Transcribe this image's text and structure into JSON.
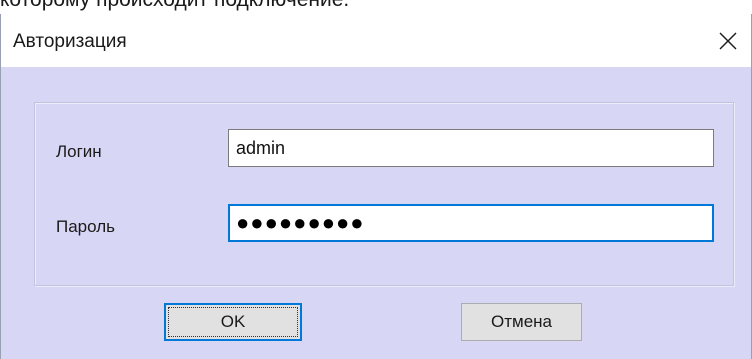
{
  "document": {
    "fragment_text": "которому происходит подключение."
  },
  "dialog": {
    "title": "Авторизация",
    "close_icon": "close-icon"
  },
  "form": {
    "login_label": "Логин",
    "login_value": "admin",
    "password_label": "Пароль",
    "password_value": "●●●●●●●●●"
  },
  "buttons": {
    "ok_label": "OK",
    "cancel_label": "Отмена"
  },
  "colors": {
    "client_bg": "#d7d7f5",
    "focus_border": "#0078d7",
    "button_bg": "#e1e1e1"
  }
}
